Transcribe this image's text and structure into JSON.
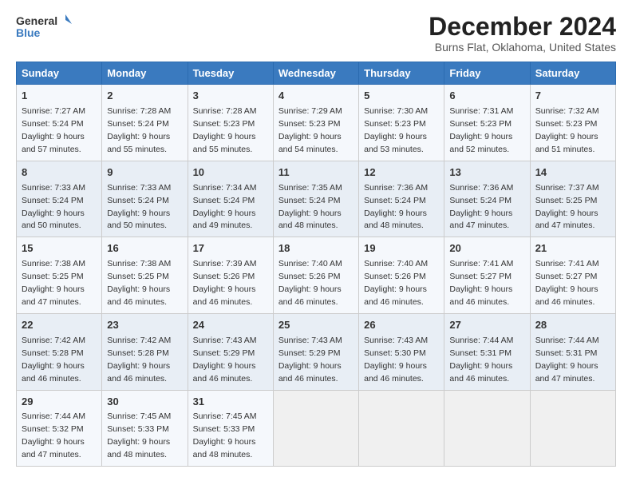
{
  "header": {
    "logo_line1": "General",
    "logo_line2": "Blue",
    "title": "December 2024",
    "subtitle": "Burns Flat, Oklahoma, United States"
  },
  "weekdays": [
    "Sunday",
    "Monday",
    "Tuesday",
    "Wednesday",
    "Thursday",
    "Friday",
    "Saturday"
  ],
  "weeks": [
    [
      {
        "day": "1",
        "sunrise": "7:27 AM",
        "sunset": "5:24 PM",
        "daylight": "9 hours and 57 minutes."
      },
      {
        "day": "2",
        "sunrise": "7:28 AM",
        "sunset": "5:24 PM",
        "daylight": "9 hours and 55 minutes."
      },
      {
        "day": "3",
        "sunrise": "7:28 AM",
        "sunset": "5:23 PM",
        "daylight": "9 hours and 55 minutes."
      },
      {
        "day": "4",
        "sunrise": "7:29 AM",
        "sunset": "5:23 PM",
        "daylight": "9 hours and 54 minutes."
      },
      {
        "day": "5",
        "sunrise": "7:30 AM",
        "sunset": "5:23 PM",
        "daylight": "9 hours and 53 minutes."
      },
      {
        "day": "6",
        "sunrise": "7:31 AM",
        "sunset": "5:23 PM",
        "daylight": "9 hours and 52 minutes."
      },
      {
        "day": "7",
        "sunrise": "7:32 AM",
        "sunset": "5:23 PM",
        "daylight": "9 hours and 51 minutes."
      }
    ],
    [
      {
        "day": "8",
        "sunrise": "7:33 AM",
        "sunset": "5:24 PM",
        "daylight": "9 hours and 50 minutes."
      },
      {
        "day": "9",
        "sunrise": "7:33 AM",
        "sunset": "5:24 PM",
        "daylight": "9 hours and 50 minutes."
      },
      {
        "day": "10",
        "sunrise": "7:34 AM",
        "sunset": "5:24 PM",
        "daylight": "9 hours and 49 minutes."
      },
      {
        "day": "11",
        "sunrise": "7:35 AM",
        "sunset": "5:24 PM",
        "daylight": "9 hours and 48 minutes."
      },
      {
        "day": "12",
        "sunrise": "7:36 AM",
        "sunset": "5:24 PM",
        "daylight": "9 hours and 48 minutes."
      },
      {
        "day": "13",
        "sunrise": "7:36 AM",
        "sunset": "5:24 PM",
        "daylight": "9 hours and 47 minutes."
      },
      {
        "day": "14",
        "sunrise": "7:37 AM",
        "sunset": "5:25 PM",
        "daylight": "9 hours and 47 minutes."
      }
    ],
    [
      {
        "day": "15",
        "sunrise": "7:38 AM",
        "sunset": "5:25 PM",
        "daylight": "9 hours and 47 minutes."
      },
      {
        "day": "16",
        "sunrise": "7:38 AM",
        "sunset": "5:25 PM",
        "daylight": "9 hours and 46 minutes."
      },
      {
        "day": "17",
        "sunrise": "7:39 AM",
        "sunset": "5:26 PM",
        "daylight": "9 hours and 46 minutes."
      },
      {
        "day": "18",
        "sunrise": "7:40 AM",
        "sunset": "5:26 PM",
        "daylight": "9 hours and 46 minutes."
      },
      {
        "day": "19",
        "sunrise": "7:40 AM",
        "sunset": "5:26 PM",
        "daylight": "9 hours and 46 minutes."
      },
      {
        "day": "20",
        "sunrise": "7:41 AM",
        "sunset": "5:27 PM",
        "daylight": "9 hours and 46 minutes."
      },
      {
        "day": "21",
        "sunrise": "7:41 AM",
        "sunset": "5:27 PM",
        "daylight": "9 hours and 46 minutes."
      }
    ],
    [
      {
        "day": "22",
        "sunrise": "7:42 AM",
        "sunset": "5:28 PM",
        "daylight": "9 hours and 46 minutes."
      },
      {
        "day": "23",
        "sunrise": "7:42 AM",
        "sunset": "5:28 PM",
        "daylight": "9 hours and 46 minutes."
      },
      {
        "day": "24",
        "sunrise": "7:43 AM",
        "sunset": "5:29 PM",
        "daylight": "9 hours and 46 minutes."
      },
      {
        "day": "25",
        "sunrise": "7:43 AM",
        "sunset": "5:29 PM",
        "daylight": "9 hours and 46 minutes."
      },
      {
        "day": "26",
        "sunrise": "7:43 AM",
        "sunset": "5:30 PM",
        "daylight": "9 hours and 46 minutes."
      },
      {
        "day": "27",
        "sunrise": "7:44 AM",
        "sunset": "5:31 PM",
        "daylight": "9 hours and 46 minutes."
      },
      {
        "day": "28",
        "sunrise": "7:44 AM",
        "sunset": "5:31 PM",
        "daylight": "9 hours and 47 minutes."
      }
    ],
    [
      {
        "day": "29",
        "sunrise": "7:44 AM",
        "sunset": "5:32 PM",
        "daylight": "9 hours and 47 minutes."
      },
      {
        "day": "30",
        "sunrise": "7:45 AM",
        "sunset": "5:33 PM",
        "daylight": "9 hours and 48 minutes."
      },
      {
        "day": "31",
        "sunrise": "7:45 AM",
        "sunset": "5:33 PM",
        "daylight": "9 hours and 48 minutes."
      },
      null,
      null,
      null,
      null
    ]
  ]
}
